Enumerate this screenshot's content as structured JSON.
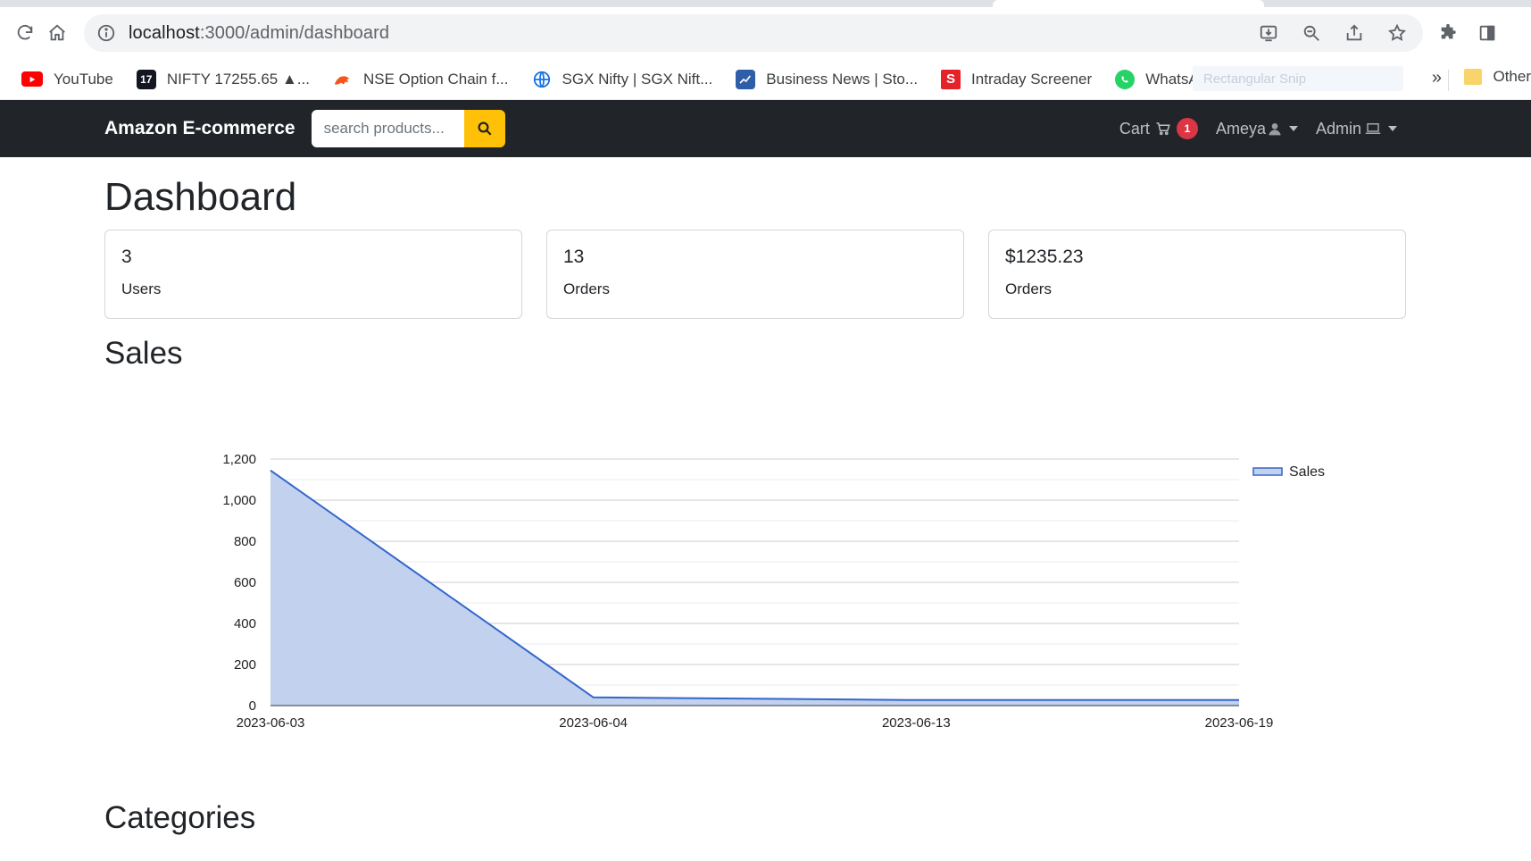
{
  "browser": {
    "url_host": "localhost",
    "url_path": ":3000/admin/dashboard",
    "bookmarks": [
      {
        "label": "YouTube",
        "icon": "youtube-icon",
        "color": "#ff0000"
      },
      {
        "label": "NIFTY 17255.65 ▲...",
        "icon": "tradingview-icon",
        "color": "#131722"
      },
      {
        "label": "NSE Option Chain f...",
        "icon": "nse-icon",
        "color": "#f5541e"
      },
      {
        "label": "SGX Nifty | SGX Nift...",
        "icon": "globe-icon",
        "color": "#1a73e8"
      },
      {
        "label": "Business News | Sto...",
        "icon": "chart-icon",
        "color": "#2f5ea8"
      },
      {
        "label": "Intraday Screener",
        "icon": "screener-icon",
        "color": "#e52228"
      },
      {
        "label": "WhatsApp",
        "icon": "whatsapp-icon",
        "color": "#25d366"
      }
    ],
    "overflow": "»",
    "other_folder": "Other",
    "snip_ghost": "Rectangular Snip"
  },
  "navbar": {
    "brand": "Amazon E-commerce",
    "search_placeholder": "search products...",
    "cart_label": "Cart",
    "cart_count": "1",
    "user_label": "Ameya",
    "admin_label": "Admin"
  },
  "page": {
    "title": "Dashboard",
    "cards": [
      {
        "value": "3",
        "label": "Users"
      },
      {
        "value": "13",
        "label": "Orders"
      },
      {
        "value": "$1235.23",
        "label": "Orders"
      }
    ],
    "sales_heading": "Sales",
    "categories_heading": "Categories"
  },
  "chart_data": {
    "type": "area",
    "x": [
      "2023-06-03",
      "2023-06-04",
      "2023-06-13",
      "2023-06-19"
    ],
    "series": [
      {
        "name": "Sales",
        "values": [
          1145,
          40,
          27,
          27
        ]
      }
    ],
    "yticks": [
      "0",
      "200",
      "400",
      "600",
      "800",
      "1,000",
      "1,200"
    ],
    "ylim": [
      0,
      1200
    ],
    "grid": true,
    "legend": "right",
    "colors": {
      "line": "#3366cc",
      "fill": "#c2d1ee"
    }
  }
}
